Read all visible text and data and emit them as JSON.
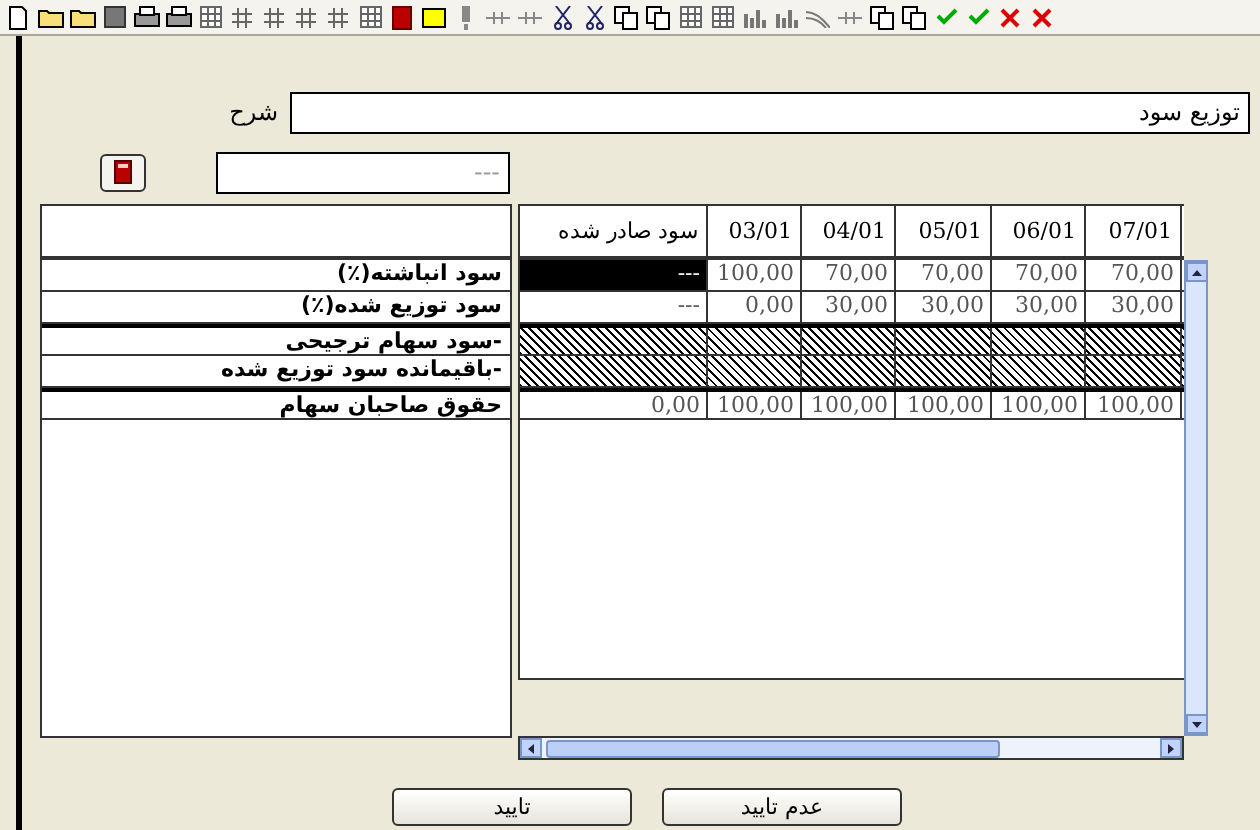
{
  "form": {
    "description_label": "شرح",
    "description_value": "توزیع سود",
    "code_placeholder": "---"
  },
  "grid": {
    "columns": [
      "سود صادر شده",
      "03/01",
      "04/01",
      "05/01",
      "06/01",
      "07/01"
    ],
    "rows": [
      {
        "label": "سود انباشته(٪)",
        "hatched": false,
        "separator_above": false,
        "cells": [
          {
            "text": "---",
            "selected": true
          },
          {
            "text": "100,00",
            "selected": false
          },
          {
            "text": "70,00",
            "selected": false
          },
          {
            "text": "70,00",
            "selected": false
          },
          {
            "text": "70,00",
            "selected": false
          },
          {
            "text": "70,00",
            "selected": false
          }
        ]
      },
      {
        "label": "سود توزیع شده(٪)",
        "hatched": false,
        "separator_above": false,
        "cells": [
          {
            "text": "---",
            "selected": false
          },
          {
            "text": "0,00",
            "selected": false
          },
          {
            "text": "30,00",
            "selected": false
          },
          {
            "text": "30,00",
            "selected": false
          },
          {
            "text": "30,00",
            "selected": false
          },
          {
            "text": "30,00",
            "selected": false
          }
        ]
      },
      {
        "label": "-سود سهام ترجیحی",
        "hatched": true,
        "separator_above": true,
        "cells": []
      },
      {
        "label": "-باقیمانده سود توزیع شده",
        "hatched": true,
        "separator_above": false,
        "cells": []
      },
      {
        "label": "حقوق صاحبان سهام",
        "hatched": false,
        "separator_above": true,
        "cells": [
          {
            "text": "0,00",
            "selected": false
          },
          {
            "text": "100,00",
            "selected": false
          },
          {
            "text": "100,00",
            "selected": false
          },
          {
            "text": "100,00",
            "selected": false
          },
          {
            "text": "100,00",
            "selected": false
          },
          {
            "text": "100,00",
            "selected": false
          }
        ]
      }
    ]
  },
  "buttons": [
    {
      "label": "عدم تایید"
    },
    {
      "label": "تایید"
    }
  ]
}
